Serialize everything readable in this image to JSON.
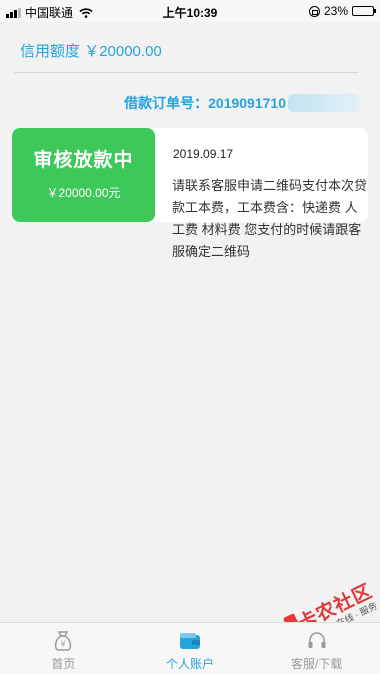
{
  "status_bar": {
    "carrier": "中国联通",
    "time": "上午10:39",
    "battery": "23%",
    "battery_level": 0.23
  },
  "credit": {
    "label": "信用额度",
    "amount": "￥20000.00"
  },
  "order": {
    "label": "借款订单号：",
    "number_visible": "2019091710"
  },
  "loan_card": {
    "status": "审核放款中",
    "amount": "￥20000.00元",
    "date": "2019.09.17",
    "message": "请联系客服申请二维码支付本次贷款工本费，工本费含：快递费 人工费 材料费 您支付的时候请跟客服确定二维码"
  },
  "tab_bar": {
    "tabs": [
      {
        "label": "首页",
        "icon": "money-bag-icon",
        "active": false
      },
      {
        "label": "个人账户",
        "icon": "wallet-icon",
        "active": true
      },
      {
        "label": "客服/下载",
        "icon": "headset-icon",
        "active": false
      }
    ]
  },
  "watermark": {
    "text": "卡农社区",
    "subtext": "金融 · 在线 · 服务"
  },
  "colors": {
    "accent_blue": "#23a4dc",
    "status_green": "#3ec85a",
    "watermark_red": "#e03a3a"
  }
}
